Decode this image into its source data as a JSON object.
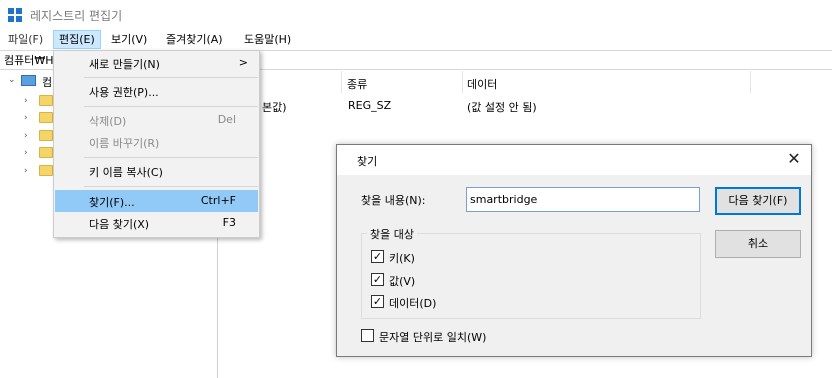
{
  "window": {
    "title": "레지스트리 편집기"
  },
  "menubar": {
    "items": [
      {
        "label": "파일(F)"
      },
      {
        "label": "편집(E)"
      },
      {
        "label": "보기(V)"
      },
      {
        "label": "즐겨찾기(A)"
      },
      {
        "label": "도움말(H)"
      }
    ]
  },
  "address": {
    "path": "컴퓨터₩H"
  },
  "tree": {
    "root_label": "컴"
  },
  "list": {
    "headers": {
      "type": "종류",
      "data": "데이터"
    },
    "rows": [
      {
        "name": "본값)",
        "type": "REG_SZ",
        "data": "(값 설정 안 됨)"
      }
    ]
  },
  "edit_menu": {
    "items": [
      {
        "label": "새로 만들기(N)",
        "shortcut": "",
        "submenu_arrow": ">"
      },
      {
        "label": "사용 권한(P)...",
        "shortcut": ""
      },
      {
        "label": "삭제(D)",
        "shortcut": "Del"
      },
      {
        "label": "이름 바꾸기(R)",
        "shortcut": ""
      },
      {
        "label": "키 이름 복사(C)",
        "shortcut": ""
      },
      {
        "label": "찾기(F)...",
        "shortcut": "Ctrl+F"
      },
      {
        "label": "다음 찾기(X)",
        "shortcut": "F3"
      }
    ]
  },
  "find_dialog": {
    "title": "찾기",
    "close_glyph": "✕",
    "find_label": "찾을 내용(N):",
    "find_value": "smartbridge",
    "find_next_button": "다음 찾기(F)",
    "cancel_button": "취소",
    "look_at_title": "찾을 대상",
    "options": [
      {
        "label": "키(K)",
        "checked": true
      },
      {
        "label": "값(V)",
        "checked": true
      },
      {
        "label": "데이터(D)",
        "checked": true
      }
    ],
    "match_whole": {
      "label": "문자열 단위로 일치(W)",
      "checked": false
    }
  },
  "colors": {
    "menu_highlight": "#91c9f7",
    "menubar_active": "#cce8ff",
    "default_button_border": "#0078d7",
    "folder": "#f6d568"
  }
}
